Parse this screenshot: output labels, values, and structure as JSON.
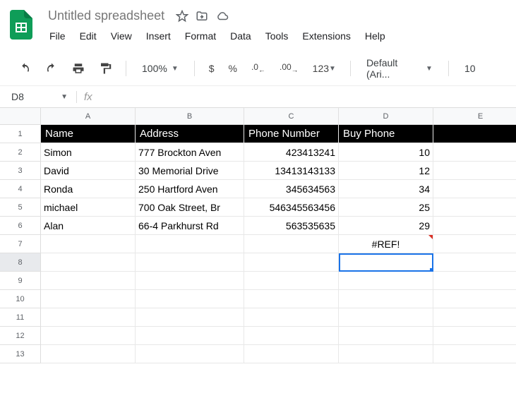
{
  "header": {
    "title": "Untitled spreadsheet",
    "menus": [
      "File",
      "Edit",
      "View",
      "Insert",
      "Format",
      "Data",
      "Tools",
      "Extensions",
      "Help"
    ]
  },
  "toolbar": {
    "zoom": "100%",
    "dollar": "$",
    "percent": "%",
    "dec_dec": ".0",
    "inc_dec": ".00",
    "num_fmt": "123",
    "font": "Default (Ari...",
    "font_size": "10"
  },
  "namebox": "D8",
  "fx": "fx",
  "columns": [
    "A",
    "B",
    "C",
    "D",
    "E"
  ],
  "rows": [
    "1",
    "2",
    "3",
    "4",
    "5",
    "6",
    "7",
    "8",
    "9",
    "10",
    "11",
    "12",
    "13"
  ],
  "table_headers": {
    "a": "Name",
    "b": "Address",
    "c": "Phone Number",
    "d": "Buy Phone"
  },
  "data": [
    {
      "a": "Simon",
      "b": "777 Brockton Aven",
      "c": "423413241",
      "d": "10"
    },
    {
      "a": "David",
      "b": "30 Memorial Drive",
      "c": "13413143133",
      "d": "12"
    },
    {
      "a": "Ronda",
      "b": "250 Hartford Aven",
      "c": "345634563",
      "d": "34"
    },
    {
      "a": "michael",
      "b": "700 Oak Street, Br",
      "c": "546345563456",
      "d": "25"
    },
    {
      "a": "Alan",
      "b": "66-4 Parkhurst Rd",
      "c": "563535635",
      "d": "29"
    }
  ],
  "error": "#REF!",
  "active_cell": "D8"
}
